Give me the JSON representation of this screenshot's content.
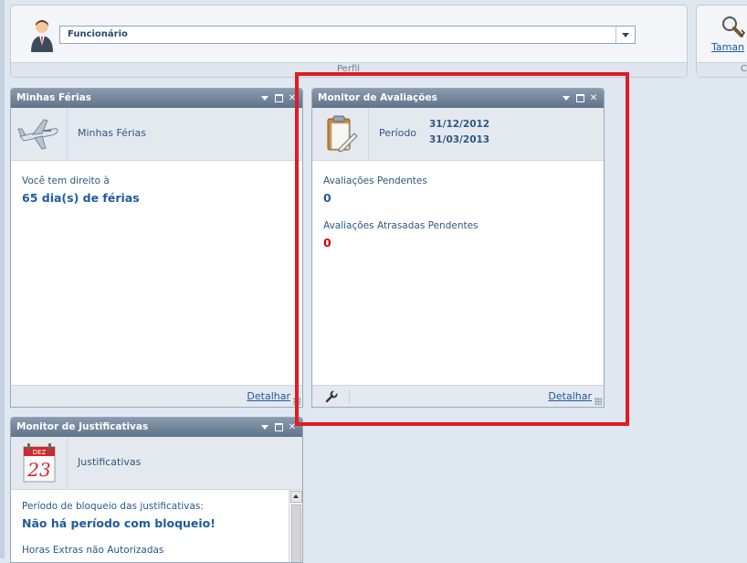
{
  "profile": {
    "selected": "Funcionário",
    "footer_label": "Perfil"
  },
  "tools": {
    "size_link": "Taman",
    "footer_label": "C"
  },
  "ferias": {
    "title": "Minhas Férias",
    "header_label": "Minhas Férias",
    "entitled_label": "Você tem direito à",
    "days_value": "65 dia(s) de férias",
    "detail_link": "Detalhar"
  },
  "avaliacoes": {
    "title": "Monitor de Avaliações",
    "period_label": "Período",
    "period_start": "31/12/2012",
    "period_end": "31/03/2013",
    "pending_label": "Avaliações Pendentes",
    "pending_value": "0",
    "late_label": "Avaliações Atrasadas Pendentes",
    "late_value": "0",
    "detail_link": "Detalhar",
    "late_color": "#d40000"
  },
  "justificativas": {
    "title": "Monitor de Justificativas",
    "header_label": "Justificativas",
    "calendar_month": "DEZ",
    "calendar_day": "23",
    "block_label": "Período de bloqueio das justificativas:",
    "block_value": "Não há período com bloqueio!",
    "overtime_label": "Horas Extras não Autorizadas"
  },
  "colors": {
    "title_bar": "#6f8298",
    "link": "#1f58a0",
    "highlight": "#e01b24"
  }
}
